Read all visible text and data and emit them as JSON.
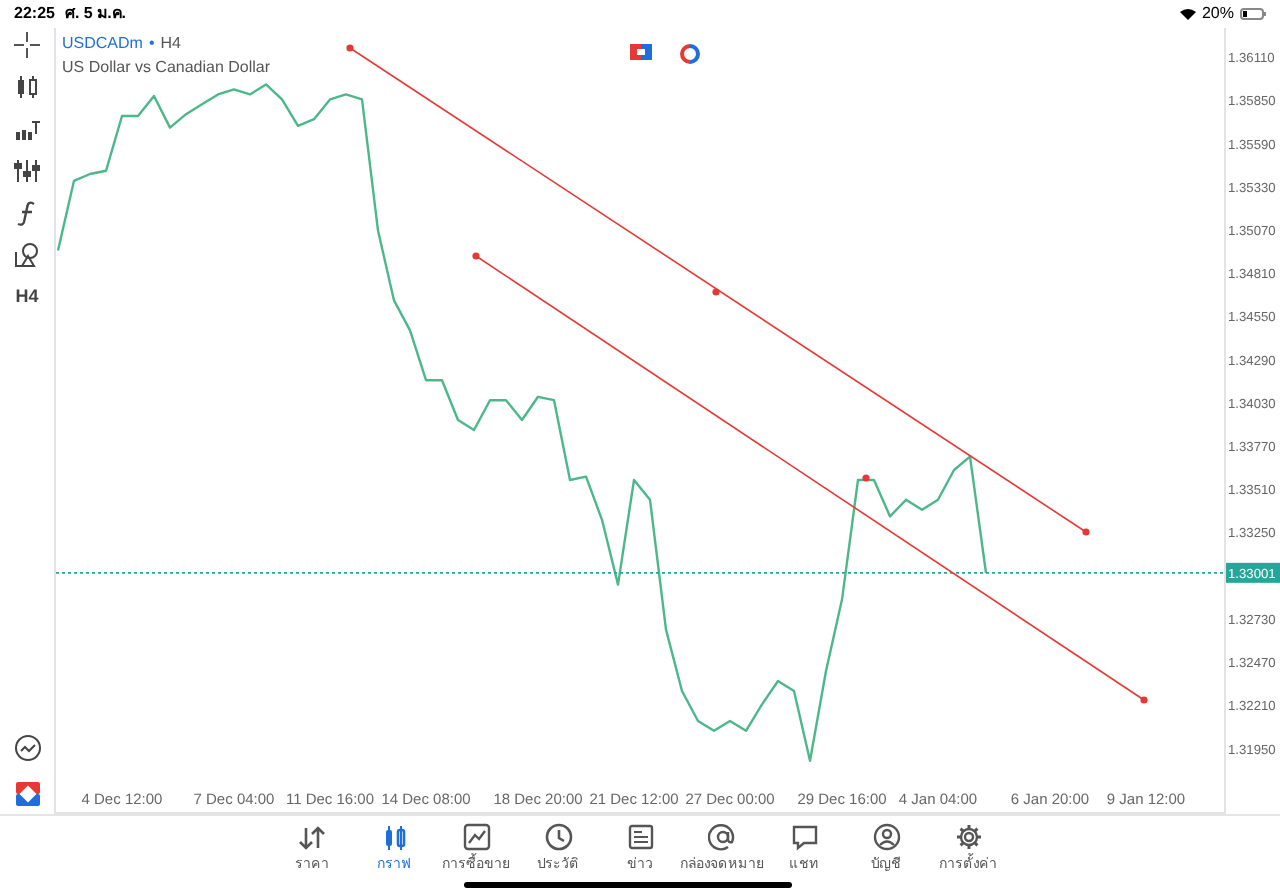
{
  "status_bar": {
    "time": "22:25",
    "date": "ศ. 5 ม.ค.",
    "battery": "20%"
  },
  "chart_header": {
    "symbol": "USDCADm",
    "separator": "•",
    "timeframe": "H4",
    "description": "US Dollar vs Canadian Dollar"
  },
  "left_toolbar": {
    "timeframe_button": "H4"
  },
  "chart": {
    "chart_data": {
      "type": "line",
      "categories": [
        null,
        null,
        null,
        null,
        "4 Dec 12:00",
        null,
        null,
        null,
        null,
        null,
        null,
        "7 Dec 04:00",
        null,
        null,
        null,
        null,
        null,
        "11 Dec 16:00",
        null,
        null,
        null,
        null,
        null,
        "14 Dec 08:00",
        null,
        null,
        null,
        null,
        null,
        null,
        "18 Dec 20:00",
        null,
        null,
        null,
        null,
        null,
        "21 Dec 12:00",
        null,
        null,
        null,
        null,
        null,
        "27 Dec 00:00",
        null,
        null,
        null,
        null,
        null,
        null,
        "29 Dec 16:00",
        null,
        null,
        null,
        null,
        null,
        "4 Jan 04:00",
        null,
        null,
        null,
        null,
        null,
        null,
        "6 Jan 20:00",
        null,
        null,
        null,
        null,
        null,
        "9 Jan 12:00",
        null
      ],
      "series": [
        {
          "color": "#4cb88a",
          "values": [
            1.3494,
            1.3536,
            1.354,
            1.3542,
            1.3575,
            1.3575,
            1.3587,
            1.3568,
            1.3576,
            1.3582,
            1.3588,
            1.3591,
            1.3588,
            1.3594,
            1.3585,
            1.3569,
            1.3573,
            1.3585,
            1.3588,
            1.3585,
            1.3506,
            1.3464,
            1.3446,
            1.3416,
            1.3416,
            1.3392,
            1.3386,
            1.3404,
            1.3404,
            1.3392,
            1.3406,
            1.3404,
            1.3356,
            1.3358,
            1.3332,
            1.3293,
            1.3356,
            1.3344,
            1.3266,
            1.3229,
            1.3211,
            1.3205,
            1.3211,
            1.3205,
            1.3221,
            1.3235,
            1.3229,
            1.3187,
            1.3241,
            1.3284,
            1.3356,
            1.3356,
            1.3334,
            1.3344,
            1.3338,
            1.3344,
            1.3362,
            1.337,
            1.33,
            null,
            null,
            null,
            null,
            null,
            null,
            null,
            null,
            null,
            null,
            null
          ]
        }
      ],
      "ylim": [
        1.3155,
        1.36279
      ],
      "ref_lines": [
        {
          "axis": "y",
          "value": 1.33001,
          "label": "1.33001",
          "color": "#26a69a"
        }
      ],
      "yticks": [
        {
          "value": 1.3611,
          "label": "1.36110"
        },
        {
          "value": 1.3585,
          "label": "1.35850"
        },
        {
          "value": 1.3559,
          "label": "1.35590"
        },
        {
          "value": 1.3533,
          "label": "1.35330"
        },
        {
          "value": 1.3507,
          "label": "1.35070"
        },
        {
          "value": 1.3481,
          "label": "1.34810"
        },
        {
          "value": 1.3455,
          "label": "1.34550"
        },
        {
          "value": 1.3429,
          "label": "1.34290"
        },
        {
          "value": 1.3403,
          "label": "1.34030"
        },
        {
          "value": 1.3377,
          "label": "1.33770"
        },
        {
          "value": 1.3351,
          "label": "1.33510"
        },
        {
          "value": 1.3325,
          "label": "1.33250"
        },
        {
          "value": 1.3273,
          "label": "1.32730"
        },
        {
          "value": 1.3247,
          "label": "1.32470"
        },
        {
          "value": 1.3221,
          "label": "1.32210"
        },
        {
          "value": 1.3195,
          "label": "1.31950"
        }
      ]
    }
  },
  "tab_bar": [
    {
      "kind": "quotes",
      "label": "ราคา",
      "selected": false
    },
    {
      "kind": "chart",
      "label": "กราฟ",
      "selected": true
    },
    {
      "kind": "trade",
      "label": "การซื้อขาย",
      "selected": false
    },
    {
      "kind": "history",
      "label": "ประวัติ",
      "selected": false
    },
    {
      "kind": "news",
      "label": "ข่าว",
      "selected": false
    },
    {
      "kind": "mailbox",
      "label": "กล่องจดหมาย",
      "selected": false
    },
    {
      "kind": "chat",
      "label": "แชท",
      "selected": false
    },
    {
      "kind": "account",
      "label": "บัญชี",
      "selected": false
    },
    {
      "kind": "settings",
      "label": "การตั้งค่า",
      "selected": false
    }
  ]
}
